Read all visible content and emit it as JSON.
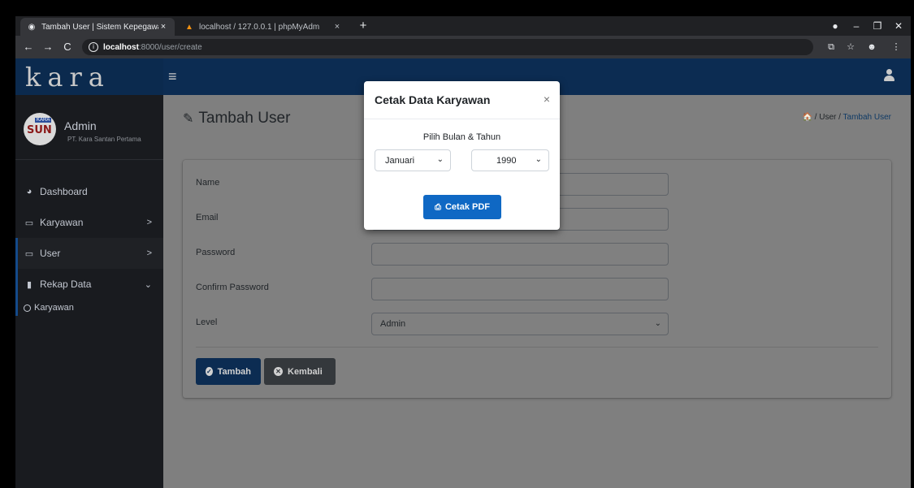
{
  "browser": {
    "tabs": [
      {
        "title": "Tambah User | Sistem Kepegawai",
        "active": true
      },
      {
        "title": "localhost / 127.0.0.1 | phpMyAdm",
        "active": false
      }
    ],
    "new_tab": "+",
    "address": {
      "host": "localhost",
      "path": ":8000/user/create"
    },
    "icons": [
      "back-icon",
      "forward-icon",
      "reload-icon",
      "info-icon",
      "translate-icon",
      "star-icon",
      "profile-icon",
      "menu-icon"
    ]
  },
  "app": {
    "brand": "kara",
    "user": {
      "name": "Admin",
      "company": "PT. Kara Santan Pertama",
      "avatar_text": "SUN",
      "avatar_tag": "KARA"
    },
    "sidebar": {
      "items": [
        {
          "label": "Dashboard",
          "icon": "dashboard-icon"
        },
        {
          "label": "Karyawan",
          "icon": "laptop-icon",
          "arrow": ">"
        },
        {
          "label": "User",
          "icon": "laptop-icon",
          "arrow": ">"
        },
        {
          "label": "Rekap Data",
          "icon": "file-icon",
          "arrow": "⌄"
        }
      ],
      "subitems": [
        {
          "label": "Karyawan"
        }
      ]
    },
    "page": {
      "title": "Tambah User",
      "breadcrumb": {
        "home": "🏠",
        "sep": "/",
        "parent": "User",
        "current": "Tambah User"
      }
    },
    "form": {
      "fields": [
        {
          "label": "Name",
          "value": ""
        },
        {
          "label": "Email",
          "value": ""
        },
        {
          "label": "Password",
          "value": ""
        },
        {
          "label": "Confirm Password",
          "value": ""
        },
        {
          "label": "Level",
          "value": "Admin"
        }
      ],
      "buttons": {
        "submit": "Tambah",
        "back": "Kembali"
      }
    },
    "modal": {
      "title": "Cetak Data Karyawan",
      "close": "×",
      "subtitle": "Pilih Bulan & Tahun",
      "month": "Januari",
      "year": "1990",
      "print_button": "Cetak PDF"
    }
  }
}
